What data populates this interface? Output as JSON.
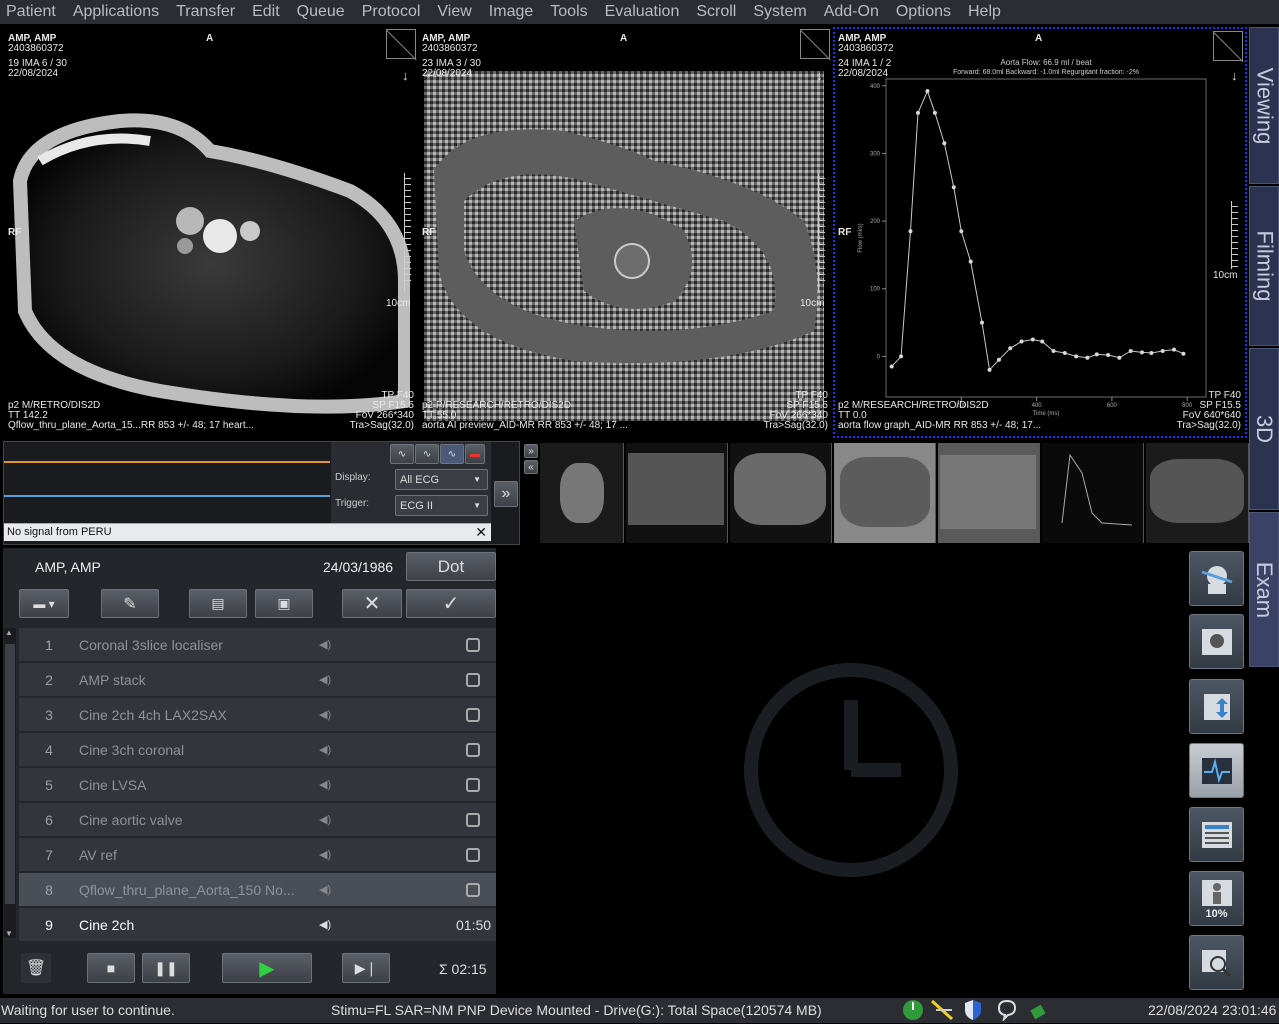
{
  "menu": [
    "Patient",
    "Applications",
    "Transfer",
    "Edit",
    "Queue",
    "Protocol",
    "View",
    "Image",
    "Tools",
    "Evaluation",
    "Scroll",
    "System",
    "Add-On",
    "Options",
    "Help"
  ],
  "viewports": [
    {
      "name": "AMP, AMP",
      "id": "2403860372",
      "series": "19 IMA 6 / 30",
      "date": "22/08/2024",
      "orient_top": "A",
      "orient_left": "RF",
      "scale": "10cm",
      "br1": "TP F40",
      "br2": "SP F15.5",
      "br3": "FoV 266*340",
      "br4": "Tra>Sag(32.0)",
      "bl1": "p2 M/RETRO/DIS2D",
      "bl2": "TT 142.2",
      "bl3": "Qflow_thru_plane_Aorta_15...RR 853 +/- 48; 17 heart..."
    },
    {
      "name": "AMP, AMP",
      "id": "2403860372",
      "series": "23 IMA 3 / 30",
      "date": "22/08/2024",
      "orient_top": "A",
      "orient_left": "RF",
      "scale": "10cm",
      "br1": "TP F40",
      "br2": "SP F15.5",
      "br3": "FoV 266*340",
      "br4": "Tra>Sag(32.0)",
      "bl1": "p2 P/RESEARCH/RETRO/DIS2D",
      "bl2": "TT 55.0",
      "bl3": "aorta AI preview_AID-MR          RR 853 +/- 48; 17 ..."
    },
    {
      "name": "AMP, AMP",
      "id": "2403860372",
      "series": "24 IMA 1 / 2",
      "date": "22/08/2024",
      "orient_top": "A",
      "orient_left": "RF",
      "scale": "10cm",
      "br1": "TP F40",
      "br2": "SP F15.5",
      "br3": "FoV 640*640",
      "br4": "Tra>Sag(32.0)",
      "bl1": "p2 M/RESEARCH/RETRO/DIS2D",
      "bl2": "TT 0.0",
      "bl3": "aorta flow graph_AID-MR        RR 853 +/- 48; 17..."
    }
  ],
  "chart_data": {
    "type": "line",
    "title": "Aorta Flow: 66.9 ml / beat",
    "subtitle": "Forward: 68.0ml Backward: -1.0ml Regurgitant fraction: -2%",
    "xlabel": "Time (ms)",
    "ylabel": "Flow (ml/s)",
    "xlim": [
      0,
      850
    ],
    "ylim": [
      -60,
      410
    ],
    "xticks": [
      200,
      400,
      600,
      800
    ],
    "yticks": [
      0,
      100,
      200,
      300,
      400
    ],
    "x": [
      15,
      40,
      65,
      85,
      110,
      130,
      155,
      180,
      200,
      225,
      255,
      275,
      300,
      330,
      360,
      390,
      415,
      445,
      475,
      505,
      535,
      560,
      590,
      620,
      650,
      680,
      705,
      735,
      765,
      790
    ],
    "values": [
      -15,
      0,
      185,
      360,
      392,
      360,
      315,
      250,
      185,
      140,
      50,
      -20,
      -5,
      12,
      22,
      25,
      22,
      8,
      5,
      0,
      -2,
      3,
      2,
      -2,
      8,
      6,
      5,
      8,
      10,
      4
    ]
  },
  "ecg": {
    "display_label": "Display:",
    "display_value": "All ECG",
    "trigger_label": "Trigger:",
    "trigger_value": "ECG II",
    "reset_label": "Reset",
    "no_signal": "No signal from PERU"
  },
  "tabs": [
    "Viewing",
    "Filming",
    "3D",
    "Exam"
  ],
  "exam": {
    "patient": "AMP, AMP",
    "dob": "24/03/1986",
    "dot_label": "Dot",
    "rows": [
      {
        "num": "1",
        "name": "Coronal 3slice localiser",
        "dur": ""
      },
      {
        "num": "2",
        "name": "AMP stack",
        "dur": ""
      },
      {
        "num": "3",
        "name": "Cine 2ch 4ch LAX2SAX",
        "dur": ""
      },
      {
        "num": "4",
        "name": "Cine 3ch coronal",
        "dur": ""
      },
      {
        "num": "5",
        "name": "Cine LVSA",
        "dur": ""
      },
      {
        "num": "6",
        "name": "Cine aortic valve",
        "dur": ""
      },
      {
        "num": "7",
        "name": "AV ref",
        "dur": ""
      },
      {
        "num": "8",
        "name": "Qflow_thru_plane_Aorta_150 No...",
        "dur": ""
      },
      {
        "num": "9",
        "name": "Cine 2ch",
        "dur": "01:50"
      }
    ],
    "total": "Σ 02:15"
  },
  "sidebar": {
    "percent": "10%"
  },
  "status": {
    "left": "Waiting for user to continue.",
    "center": "Stimu=FL SAR=NM PNP Device Mounted - Drive(G:): Total Space(120574 MB)",
    "datetime": "22/08/2024 23:01:46"
  },
  "colors": {
    "accent": "#2c3350",
    "ecg_orange": "#e0952a",
    "ecg_blue": "#5aa0d8",
    "active_border": "#2a2aff"
  }
}
